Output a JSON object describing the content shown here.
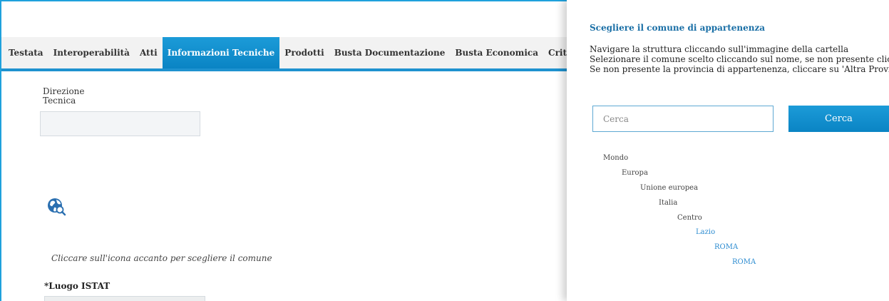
{
  "tabs": [
    {
      "label": "Testata",
      "active": false
    },
    {
      "label": "Interoperabilità",
      "active": false
    },
    {
      "label": "Atti",
      "active": false
    },
    {
      "label": "Informazioni Tecniche",
      "active": true
    },
    {
      "label": "Prodotti",
      "active": false
    },
    {
      "label": "Busta Documentazione",
      "active": false
    },
    {
      "label": "Busta Economica",
      "active": false
    },
    {
      "label": "Criteri di Valutazione",
      "active": false
    }
  ],
  "form": {
    "direzione_label_line1": "Direzione",
    "direzione_label_line2": "Tecnica",
    "direzione_value": "",
    "hint": "Cliccare sull'icona accanto per scegliere il comune",
    "luogo_istat_label": "*Luogo ISTAT",
    "luogo_istat_value": ""
  },
  "panel": {
    "title": "Scegliere il comune di appartenenza",
    "instructions": [
      "Navigare la struttura cliccando sull'immagine della cartella",
      "Selezionare il comune scelto cliccando sul nome, se non presente cliccare su",
      "Se non presente la provincia di appartenenza, cliccare su 'Altra Provincia'"
    ],
    "search_placeholder": "Cerca",
    "search_button": "Cerca",
    "tree": [
      {
        "label": "Mondo",
        "level": 0,
        "link": false
      },
      {
        "label": "Europa",
        "level": 1,
        "link": false
      },
      {
        "label": "Unione europea",
        "level": 2,
        "link": false
      },
      {
        "label": "Italia",
        "level": 3,
        "link": false
      },
      {
        "label": "Centro",
        "level": 4,
        "link": false
      },
      {
        "label": "Lazio",
        "level": 5,
        "link": true
      },
      {
        "label": "ROMA",
        "level": 6,
        "link": true
      },
      {
        "label": "ROMA",
        "level": 7,
        "link": true
      }
    ]
  },
  "colors": {
    "accent": "#1f92cf",
    "link": "#2b8bd0",
    "panel_title": "#1a6fa6"
  },
  "icons": {
    "globe_search": "globe-search-icon"
  }
}
